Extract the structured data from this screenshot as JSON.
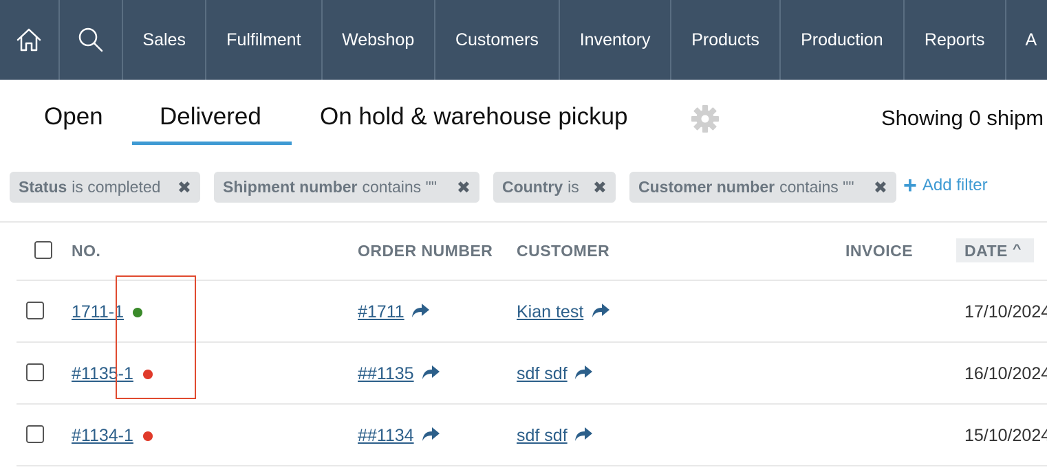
{
  "nav": {
    "items": [
      "Sales",
      "Fulfilment",
      "Webshop",
      "Customers",
      "Inventory",
      "Products",
      "Production",
      "Reports",
      "A"
    ]
  },
  "tabs": {
    "open": "Open",
    "delivered": "Delivered",
    "onhold": "On hold & warehouse pickup"
  },
  "showing": "Showing 0 shipm",
  "filters": [
    {
      "field": "Status",
      "op": "is completed"
    },
    {
      "field": "Shipment number",
      "op": "contains \"\""
    },
    {
      "field": "Country",
      "op": "is"
    },
    {
      "field": "Customer number",
      "op": "contains \"\""
    }
  ],
  "add_filter": "Add filter",
  "table": {
    "headers": {
      "no": "NO.",
      "order": "ORDER NUMBER",
      "customer": "CUSTOMER",
      "invoice": "INVOICE",
      "date": "DATE"
    },
    "rows": [
      {
        "no": "1711-1",
        "status_color": "#3a8a2a",
        "order": "#1711",
        "customer": "Kian test",
        "date": "17/10/2024"
      },
      {
        "no": "#1135-1",
        "status_color": "#e03a2a",
        "order": "##1135",
        "customer": "sdf sdf",
        "date": "16/10/2024"
      },
      {
        "no": "#1134-1",
        "status_color": "#e03a2a",
        "order": "##1134",
        "customer": "sdf sdf",
        "date": "15/10/2024"
      }
    ]
  },
  "colors": {
    "nav_bg": "#3d5166",
    "accent": "#3e9ad3",
    "link": "#2c5f8a",
    "highlight": "#e04a2f"
  }
}
